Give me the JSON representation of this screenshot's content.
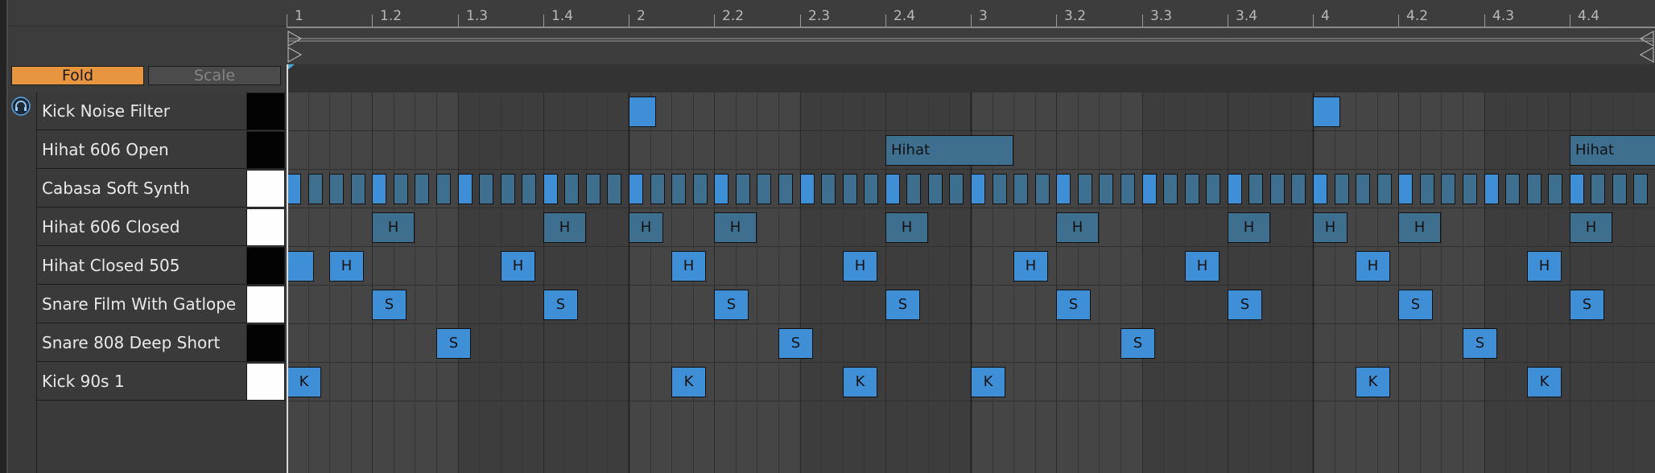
{
  "toolbar": {
    "fold_label": "Fold",
    "scale_label": "Scale"
  },
  "ruler": {
    "labels": [
      "1",
      "1.2",
      "1.3",
      "1.4",
      "2",
      "2.2",
      "2.3",
      "2.4",
      "3",
      "3.2",
      "3.3",
      "3.4",
      "4",
      "4.2",
      "4.3",
      "4.4"
    ]
  },
  "lanes": [
    {
      "name": "Kick Noise Filter",
      "key": "black"
    },
    {
      "name": "Hihat 606 Open",
      "key": "black"
    },
    {
      "name": "Cabasa Soft Synth",
      "key": "white"
    },
    {
      "name": "Hihat 606 Closed",
      "key": "white"
    },
    {
      "name": "Hihat Closed 505",
      "key": "black"
    },
    {
      "name": "Snare Film With Gatlope",
      "key": "white"
    },
    {
      "name": "Snare 808 Deep Short",
      "key": "black"
    },
    {
      "name": "Kick 90s 1",
      "key": "white"
    }
  ],
  "colors": {
    "note_selected": "#3f8fd6",
    "note_dim": "#3e6f8e",
    "accent": "#e8953f"
  },
  "notes": [
    {
      "lane": 0,
      "start": 2.0,
      "len": 0.08,
      "selected": true,
      "label": ""
    },
    {
      "lane": 0,
      "start": 4.0,
      "len": 0.08,
      "selected": true,
      "label": ""
    },
    {
      "lane": 1,
      "start": 2.75,
      "len": 0.375,
      "selected": false,
      "label": "Hihat"
    },
    {
      "lane": 1,
      "start": 4.75,
      "len": 0.375,
      "selected": false,
      "label": "Hihat"
    },
    {
      "lane": 3,
      "start": 1.25,
      "len": 0.125,
      "selected": false,
      "label": "H"
    },
    {
      "lane": 3,
      "start": 1.75,
      "len": 0.125,
      "selected": false,
      "label": "H"
    },
    {
      "lane": 3,
      "start": 2.0,
      "len": 0.1,
      "selected": false,
      "label": "H"
    },
    {
      "lane": 3,
      "start": 2.25,
      "len": 0.125,
      "selected": false,
      "label": "H"
    },
    {
      "lane": 3,
      "start": 2.75,
      "len": 0.125,
      "selected": false,
      "label": "H"
    },
    {
      "lane": 3,
      "start": 3.25,
      "len": 0.125,
      "selected": false,
      "label": "H"
    },
    {
      "lane": 3,
      "start": 3.75,
      "len": 0.125,
      "selected": false,
      "label": "H"
    },
    {
      "lane": 3,
      "start": 4.0,
      "len": 0.1,
      "selected": false,
      "label": "H"
    },
    {
      "lane": 3,
      "start": 4.25,
      "len": 0.125,
      "selected": false,
      "label": "H"
    },
    {
      "lane": 3,
      "start": 4.75,
      "len": 0.125,
      "selected": false,
      "label": "H"
    },
    {
      "lane": 4,
      "start": 1.0,
      "len": 0.08,
      "selected": true,
      "label": ""
    },
    {
      "lane": 4,
      "start": 1.125,
      "len": 0.1,
      "selected": true,
      "label": "H"
    },
    {
      "lane": 4,
      "start": 1.625,
      "len": 0.1,
      "selected": true,
      "label": "H"
    },
    {
      "lane": 4,
      "start": 2.125,
      "len": 0.1,
      "selected": true,
      "label": "H"
    },
    {
      "lane": 4,
      "start": 2.625,
      "len": 0.1,
      "selected": true,
      "label": "H"
    },
    {
      "lane": 4,
      "start": 3.125,
      "len": 0.1,
      "selected": true,
      "label": "H"
    },
    {
      "lane": 4,
      "start": 3.625,
      "len": 0.1,
      "selected": true,
      "label": "H"
    },
    {
      "lane": 4,
      "start": 4.125,
      "len": 0.1,
      "selected": true,
      "label": "H"
    },
    {
      "lane": 4,
      "start": 4.625,
      "len": 0.1,
      "selected": true,
      "label": "H"
    },
    {
      "lane": 5,
      "start": 1.25,
      "len": 0.1,
      "selected": true,
      "label": "S"
    },
    {
      "lane": 5,
      "start": 1.75,
      "len": 0.1,
      "selected": true,
      "label": "S"
    },
    {
      "lane": 5,
      "start": 2.25,
      "len": 0.1,
      "selected": true,
      "label": "S"
    },
    {
      "lane": 5,
      "start": 2.75,
      "len": 0.1,
      "selected": true,
      "label": "S"
    },
    {
      "lane": 5,
      "start": 3.25,
      "len": 0.1,
      "selected": true,
      "label": "S"
    },
    {
      "lane": 5,
      "start": 3.75,
      "len": 0.1,
      "selected": true,
      "label": "S"
    },
    {
      "lane": 5,
      "start": 4.25,
      "len": 0.1,
      "selected": true,
      "label": "S"
    },
    {
      "lane": 5,
      "start": 4.75,
      "len": 0.1,
      "selected": true,
      "label": "S"
    },
    {
      "lane": 6,
      "start": 1.4375,
      "len": 0.1,
      "selected": true,
      "label": "S"
    },
    {
      "lane": 6,
      "start": 2.4375,
      "len": 0.1,
      "selected": true,
      "label": "S"
    },
    {
      "lane": 6,
      "start": 3.4375,
      "len": 0.1,
      "selected": true,
      "label": "S"
    },
    {
      "lane": 6,
      "start": 4.4375,
      "len": 0.1,
      "selected": true,
      "label": "S"
    },
    {
      "lane": 7,
      "start": 1.0,
      "len": 0.1,
      "selected": true,
      "label": "K"
    },
    {
      "lane": 7,
      "start": 2.125,
      "len": 0.1,
      "selected": true,
      "label": "K"
    },
    {
      "lane": 7,
      "start": 2.625,
      "len": 0.1,
      "selected": true,
      "label": "K"
    },
    {
      "lane": 7,
      "start": 3.0,
      "len": 0.1,
      "selected": true,
      "label": "K"
    },
    {
      "lane": 7,
      "start": 4.125,
      "len": 0.1,
      "selected": true,
      "label": "K"
    },
    {
      "lane": 7,
      "start": 4.625,
      "len": 0.1,
      "selected": true,
      "label": "K"
    }
  ]
}
